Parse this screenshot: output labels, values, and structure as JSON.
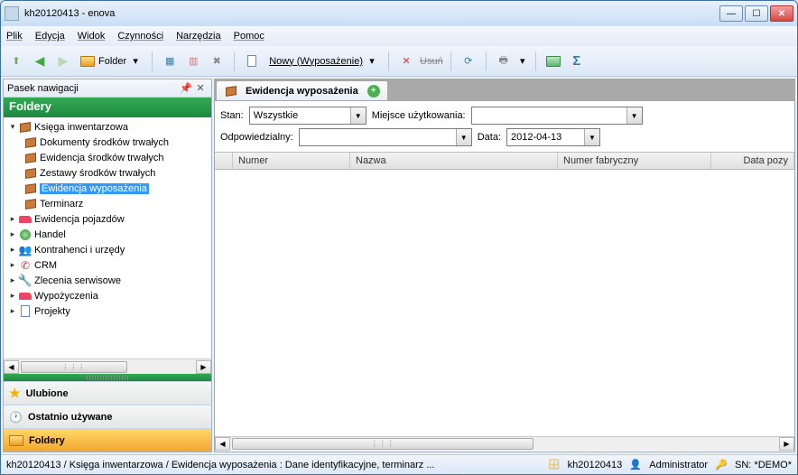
{
  "window": {
    "title": "kh20120413 - enova"
  },
  "menu": {
    "items": [
      "Plik",
      "Edycja",
      "Widok",
      "Czynności",
      "Narzędzia",
      "Pomoc"
    ]
  },
  "toolbar": {
    "folder_label": "Folder",
    "nowy_label": "Nowy (Wyposażenie)",
    "usun_label": "Usuń"
  },
  "nav": {
    "title": "Pasek nawigacji",
    "foldery_label": "Foldery",
    "tree": {
      "0": {
        "label": "Księga inwentarzowa"
      },
      "1": {
        "label": "Dokumenty środków trwałych"
      },
      "2": {
        "label": "Ewidencja środków trwałych"
      },
      "3": {
        "label": "Zestawy środków trwałych"
      },
      "4": {
        "label": "Ewidencja wyposażenia"
      },
      "5": {
        "label": "Terminarz"
      },
      "6": {
        "label": "Ewidencja pojazdów"
      },
      "7": {
        "label": "Handel"
      },
      "8": {
        "label": "Kontrahenci i urzędy"
      },
      "9": {
        "label": "CRM"
      },
      "10": {
        "label": "Zlecenia serwisowe"
      },
      "11": {
        "label": "Wypożyczenia"
      },
      "12": {
        "label": "Projekty"
      }
    },
    "acc": {
      "ulubione": "Ulubione",
      "ostatnio": "Ostatnio używane",
      "foldery": "Foldery"
    }
  },
  "tab": {
    "title": "Ewidencja wyposażenia"
  },
  "filters": {
    "stan_label": "Stan:",
    "stan_value": "Wszystkie",
    "miejsce_label": "Miejsce użytkowania:",
    "miejsce_value": "",
    "odp_label": "Odpowiedzialny:",
    "odp_value": "",
    "data_label": "Data:",
    "data_value": "2012-04-13"
  },
  "grid": {
    "cols": {
      "0": "Numer",
      "1": "Nazwa",
      "2": "Numer fabryczny",
      "3": "Data pozy"
    }
  },
  "status": {
    "path": "kh20120413 / Księga inwentarzowa / Ewidencja wyposażenia : Dane identyfikacyjne, terminarz ...",
    "db": "kh20120413",
    "user": "Administrator",
    "sn": "SN: *DEMO*"
  }
}
